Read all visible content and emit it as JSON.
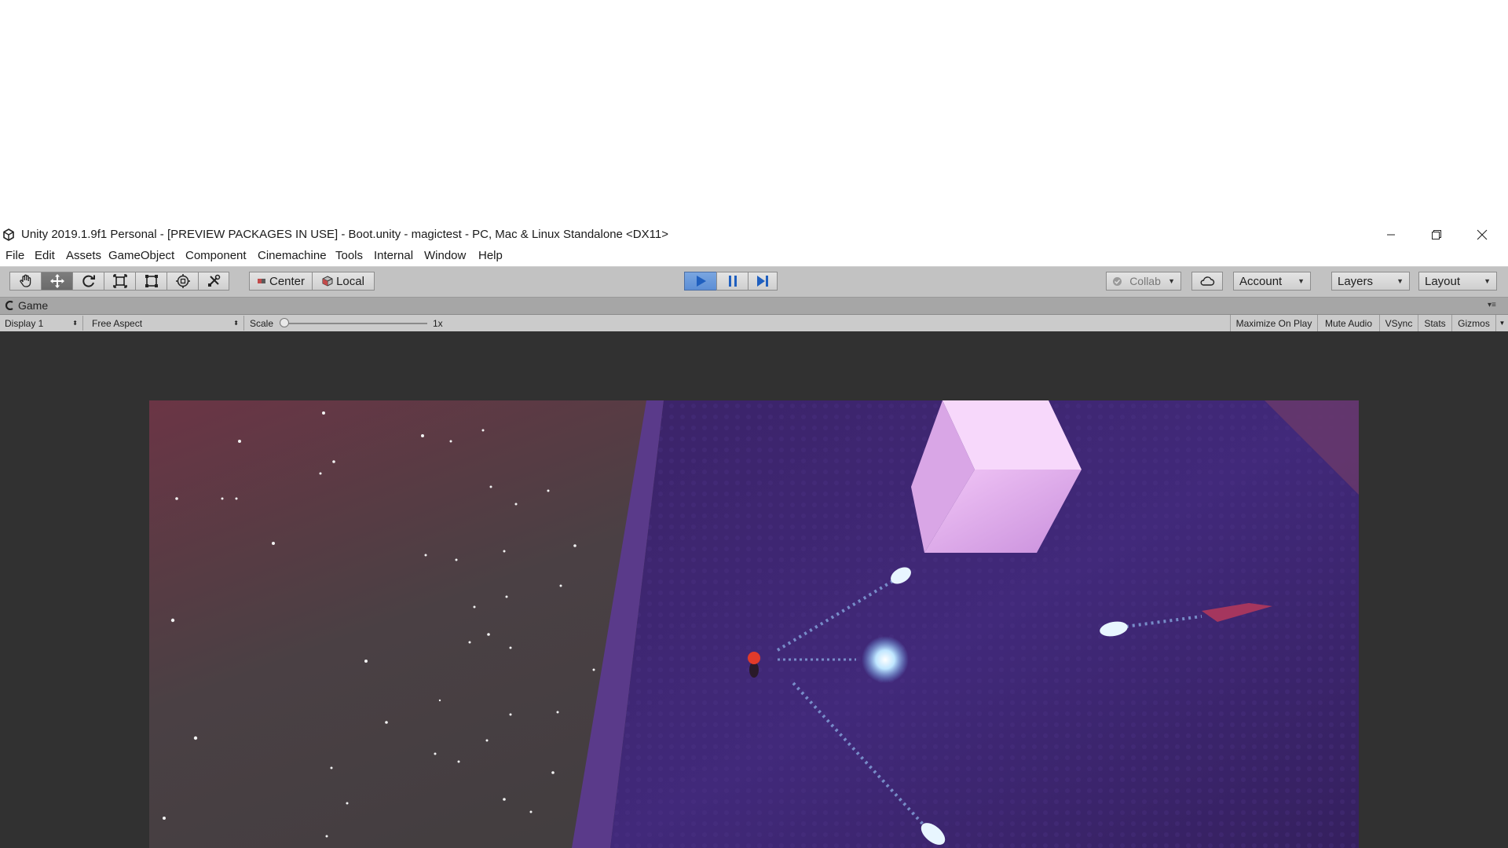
{
  "window": {
    "title": "Unity 2019.1.9f1 Personal - [PREVIEW PACKAGES IN USE] - Boot.unity - magictest - PC, Mac & Linux Standalone <DX11>",
    "controls": [
      "minimize-icon",
      "restore-icon",
      "close-icon"
    ]
  },
  "menu": {
    "items": [
      "File",
      "Edit",
      "Assets",
      "GameObject",
      "Component",
      "Cinemachine",
      "Tools",
      "Internal",
      "Window",
      "Help"
    ]
  },
  "toolbar": {
    "tools": [
      "hand-tool-icon",
      "move-tool-icon",
      "rotate-tool-icon",
      "scale-tool-icon",
      "rect-tool-icon",
      "transform-tool-icon",
      "custom-tool-icon"
    ],
    "active_tool": "move-tool-icon",
    "pivot_mode": "Center",
    "pivot_rotation": "Local",
    "play_state": "playing",
    "collab": "Collab",
    "account": "Account",
    "layers": "Layers",
    "layout": "Layout",
    "accent": "#5c8ed6"
  },
  "game_tab": {
    "label": "Game"
  },
  "game_bar": {
    "display": "Display 1",
    "aspect": "Free Aspect",
    "scale_label": "Scale",
    "scale_value": "1x",
    "toggles": [
      "Maximize On Play",
      "Mute Audio",
      "VSync",
      "Stats",
      "Gizmos"
    ]
  }
}
